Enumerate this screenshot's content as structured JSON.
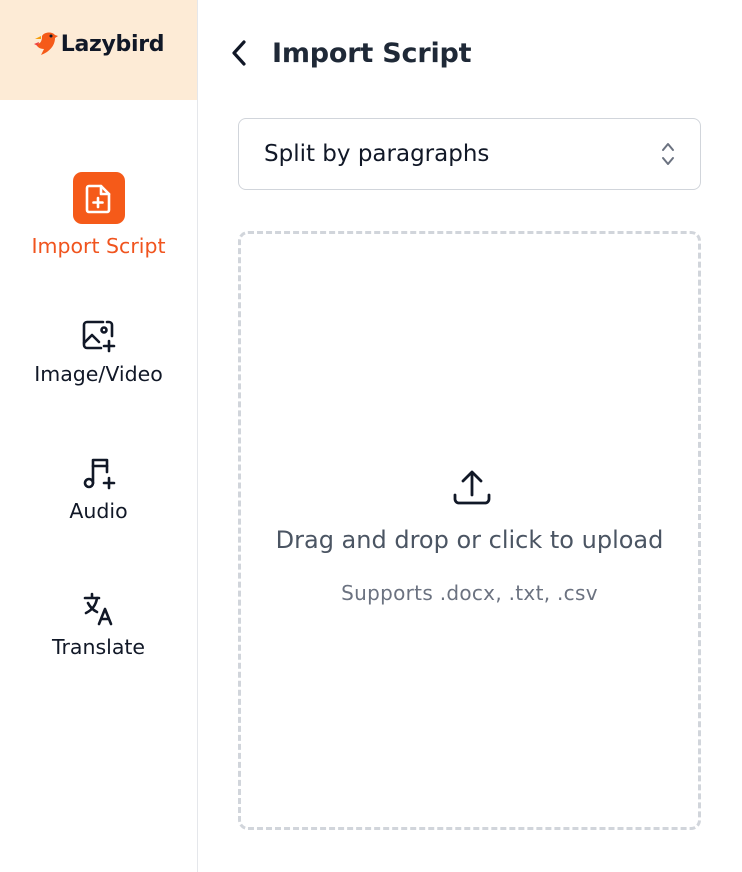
{
  "brand": {
    "name": "Lazybird",
    "logo_icon": "bird-logo-icon",
    "accent": "#f55a19",
    "header_bg": "#fdebd6"
  },
  "sidebar": {
    "items": [
      {
        "label": "Import Script",
        "icon": "file-plus-icon",
        "active": true
      },
      {
        "label": "Image/Video",
        "icon": "image-plus-icon",
        "active": false
      },
      {
        "label": "Audio",
        "icon": "music-plus-icon",
        "active": false
      },
      {
        "label": "Translate",
        "icon": "translate-icon",
        "active": false
      }
    ]
  },
  "header": {
    "title": "Import Script",
    "back_icon": "chevron-left-icon"
  },
  "split_select": {
    "value": "Split by paragraphs",
    "icon": "chevron-up-down-icon"
  },
  "dropzone": {
    "title": "Drag and drop or click to upload",
    "subtitle": "Supports .docx, .txt, .csv",
    "icon": "upload-icon"
  }
}
